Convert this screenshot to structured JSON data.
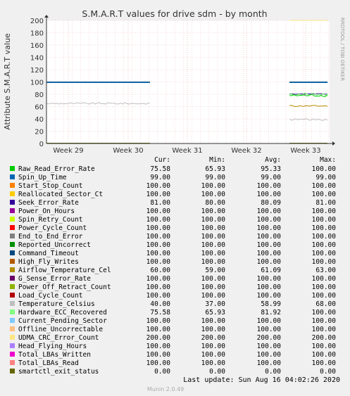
{
  "chart_data": {
    "type": "line",
    "title": "S.M.A.R.T values for drive sdm - by month",
    "ylabel": "Attribute S.M.A.R.T value",
    "side_label": "RRDTOOL / TOBI OETIKER",
    "ylim": [
      0,
      200
    ],
    "y_ticks": [
      0,
      20,
      40,
      60,
      80,
      100,
      120,
      140,
      160,
      180,
      200
    ],
    "x_ticks": [
      "Week 29",
      "Week 30",
      "Week 31",
      "Week 32",
      "Week 33"
    ],
    "grid": true,
    "legend_headers": [
      "Cur:",
      "Min:",
      "Avg:",
      "Max:"
    ],
    "series": [
      {
        "name": "Raw_Read_Error_Rate",
        "color": "#00cc00",
        "cur": "75.58",
        "min": "65.93",
        "avg": "95.33",
        "max": "100.00"
      },
      {
        "name": "Spin_Up_Time",
        "color": "#0066b3",
        "cur": "99.00",
        "min": "99.00",
        "avg": "99.00",
        "max": "99.00"
      },
      {
        "name": "Start_Stop_Count",
        "color": "#ff8000",
        "cur": "100.00",
        "min": "100.00",
        "avg": "100.00",
        "max": "100.00"
      },
      {
        "name": "Reallocated_Sector_Ct",
        "color": "#ffcc00",
        "cur": "100.00",
        "min": "100.00",
        "avg": "100.00",
        "max": "100.00"
      },
      {
        "name": "Seek_Error_Rate",
        "color": "#330099",
        "cur": "81.00",
        "min": "80.00",
        "avg": "80.09",
        "max": "81.00"
      },
      {
        "name": "Power_On_Hours",
        "color": "#990099",
        "cur": "100.00",
        "min": "100.00",
        "avg": "100.00",
        "max": "100.00"
      },
      {
        "name": "Spin_Retry_Count",
        "color": "#ccff00",
        "cur": "100.00",
        "min": "100.00",
        "avg": "100.00",
        "max": "100.00"
      },
      {
        "name": "Power_Cycle_Count",
        "color": "#ff0000",
        "cur": "100.00",
        "min": "100.00",
        "avg": "100.00",
        "max": "100.00"
      },
      {
        "name": "End_to_End_Error",
        "color": "#808080",
        "cur": "100.00",
        "min": "100.00",
        "avg": "100.00",
        "max": "100.00"
      },
      {
        "name": "Reported_Uncorrect",
        "color": "#008f00",
        "cur": "100.00",
        "min": "100.00",
        "avg": "100.00",
        "max": "100.00"
      },
      {
        "name": "Command_Timeout",
        "color": "#00487d",
        "cur": "100.00",
        "min": "100.00",
        "avg": "100.00",
        "max": "100.00"
      },
      {
        "name": "High_Fly_Writes",
        "color": "#b35a00",
        "cur": "100.00",
        "min": "100.00",
        "avg": "100.00",
        "max": "100.00"
      },
      {
        "name": "Airflow_Temperature_Cel",
        "color": "#b38f00",
        "cur": "60.00",
        "min": "59.00",
        "avg": "61.09",
        "max": "63.00"
      },
      {
        "name": "G_Sense_Error_Rate",
        "color": "#6b006b",
        "cur": "100.00",
        "min": "100.00",
        "avg": "100.00",
        "max": "100.00"
      },
      {
        "name": "Power_Off_Retract_Count",
        "color": "#8fb300",
        "cur": "100.00",
        "min": "100.00",
        "avg": "100.00",
        "max": "100.00"
      },
      {
        "name": "Load_Cycle_Count",
        "color": "#b30000",
        "cur": "100.00",
        "min": "100.00",
        "avg": "100.00",
        "max": "100.00"
      },
      {
        "name": "Temperature_Celsius",
        "color": "#bebebe",
        "cur": "40.00",
        "min": "37.00",
        "avg": "58.99",
        "max": "68.00"
      },
      {
        "name": "Hardware_ECC_Recovered",
        "color": "#80ff80",
        "cur": "75.58",
        "min": "65.93",
        "avg": "81.92",
        "max": "100.00"
      },
      {
        "name": "Current_Pending_Sector",
        "color": "#80c9ff",
        "cur": "100.00",
        "min": "100.00",
        "avg": "100.00",
        "max": "100.00"
      },
      {
        "name": "Offline_Uncorrectable",
        "color": "#ffc080",
        "cur": "100.00",
        "min": "100.00",
        "avg": "100.00",
        "max": "100.00"
      },
      {
        "name": "UDMA_CRC_Error_Count",
        "color": "#ffe680",
        "cur": "200.00",
        "min": "200.00",
        "avg": "200.00",
        "max": "200.00"
      },
      {
        "name": "Head_Flying_Hours",
        "color": "#aa80ff",
        "cur": "100.00",
        "min": "100.00",
        "avg": "100.00",
        "max": "100.00"
      },
      {
        "name": "Total_LBAs_Written",
        "color": "#ee00cc",
        "cur": "100.00",
        "min": "100.00",
        "avg": "100.00",
        "max": "100.00"
      },
      {
        "name": "Total_LBAs_Read",
        "color": "#ff8080",
        "cur": "100.00",
        "min": "100.00",
        "avg": "100.00",
        "max": "100.00"
      },
      {
        "name": "smartctl_exit_status",
        "color": "#666600",
        "cur": "0.00",
        "min": "0.00",
        "avg": "0.00",
        "max": "0.00"
      }
    ],
    "last_update": "Last update: Sun Aug 16 04:02:26 2020",
    "footer": "Munin 2.0.49"
  }
}
